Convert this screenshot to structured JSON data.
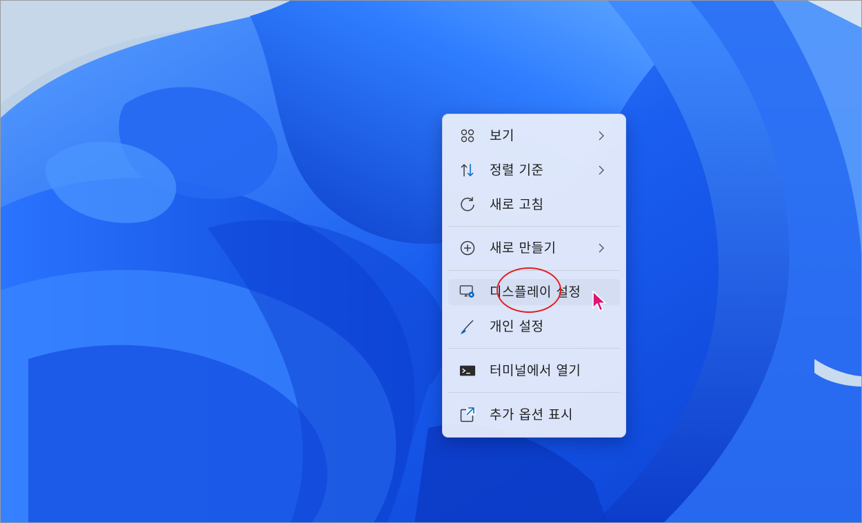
{
  "context_menu": {
    "items": [
      {
        "label": "보기",
        "icon": "view-grid-icon",
        "has_submenu": true
      },
      {
        "label": "정렬 기준",
        "icon": "sort-arrows-icon",
        "has_submenu": true
      },
      {
        "label": "새로 고침",
        "icon": "refresh-icon",
        "has_submenu": false
      },
      {
        "label": "새로 만들기",
        "icon": "add-circle-icon",
        "has_submenu": true
      },
      {
        "label": "디스플레이 설정",
        "icon": "display-settings-icon",
        "has_submenu": false,
        "hovered": true
      },
      {
        "label": "개인 설정",
        "icon": "brush-icon",
        "has_submenu": false
      },
      {
        "label": "터미널에서 열기",
        "icon": "terminal-icon",
        "has_submenu": false
      },
      {
        "label": "추가 옵션 표시",
        "icon": "open-external-icon",
        "has_submenu": false
      }
    ]
  },
  "colors": {
    "accent": "#0067c0",
    "wallpaper_primary": "#1f5ff0",
    "annotation": "#e02020",
    "cursor": "#e0157a"
  }
}
